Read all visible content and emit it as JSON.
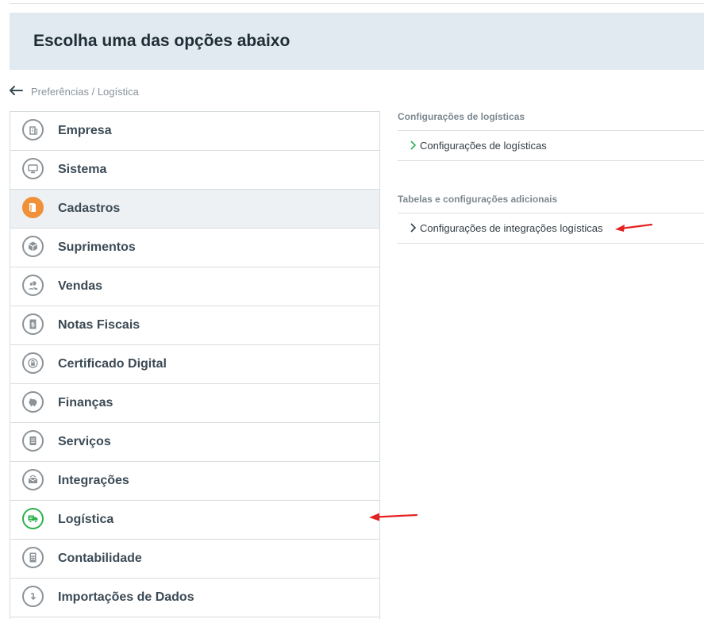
{
  "header": {
    "title": "Escolha uma das opções abaixo"
  },
  "breadcrumb": {
    "text": "Preferências / Logística"
  },
  "menu": {
    "items": [
      {
        "label": "Empresa",
        "icon": "building-icon"
      },
      {
        "label": "Sistema",
        "icon": "monitor-icon"
      },
      {
        "label": "Cadastros",
        "icon": "book-icon",
        "selected": true
      },
      {
        "label": "Suprimentos",
        "icon": "box-icon"
      },
      {
        "label": "Vendas",
        "icon": "users-icon"
      },
      {
        "label": "Notas Fiscais",
        "icon": "invoice-icon"
      },
      {
        "label": "Certificado Digital",
        "icon": "lock-icon"
      },
      {
        "label": "Finanças",
        "icon": "piggy-bank-icon"
      },
      {
        "label": "Serviços",
        "icon": "document-icon"
      },
      {
        "label": "Integrações",
        "icon": "envelope-icon"
      },
      {
        "label": "Logística",
        "icon": "truck-icon"
      },
      {
        "label": "Contabilidade",
        "icon": "calculator-icon"
      },
      {
        "label": "Importações de Dados",
        "icon": "import-icon"
      }
    ]
  },
  "sections": [
    {
      "title": "Configurações de logísticas",
      "links": [
        "Configurações de logísticas"
      ]
    },
    {
      "title": "Tabelas e configurações adicionais",
      "links": [
        "Configurações de integrações logísticas"
      ]
    }
  ],
  "colors": {
    "header_band": "#e1eaf0",
    "selected_row": "#edf1f4",
    "accent_orange": "#f0913a",
    "accent_green": "#2bb14c",
    "annotation_red": "#e52222"
  }
}
